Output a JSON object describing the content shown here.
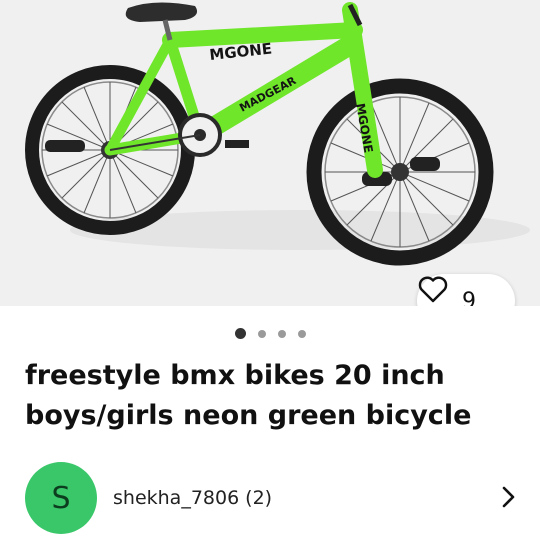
{
  "listing": {
    "watch_count": "9",
    "title_line1": "freestyle bmx bikes 20 inch",
    "title_line2": "boys/girls neon green bicycle",
    "bike_brand": "MGONE"
  },
  "carousel": {
    "total": 4,
    "active_index": 0
  },
  "seller": {
    "initial": "S",
    "username": "shekha_7806",
    "feedback_count": "(2)"
  },
  "icons": {
    "heart": "heart-icon",
    "chevron": "chevron-right-icon"
  },
  "colors": {
    "frame_green": "#6fe62a",
    "avatar_green": "#39c76a",
    "photo_background": "#f0f0f0"
  }
}
